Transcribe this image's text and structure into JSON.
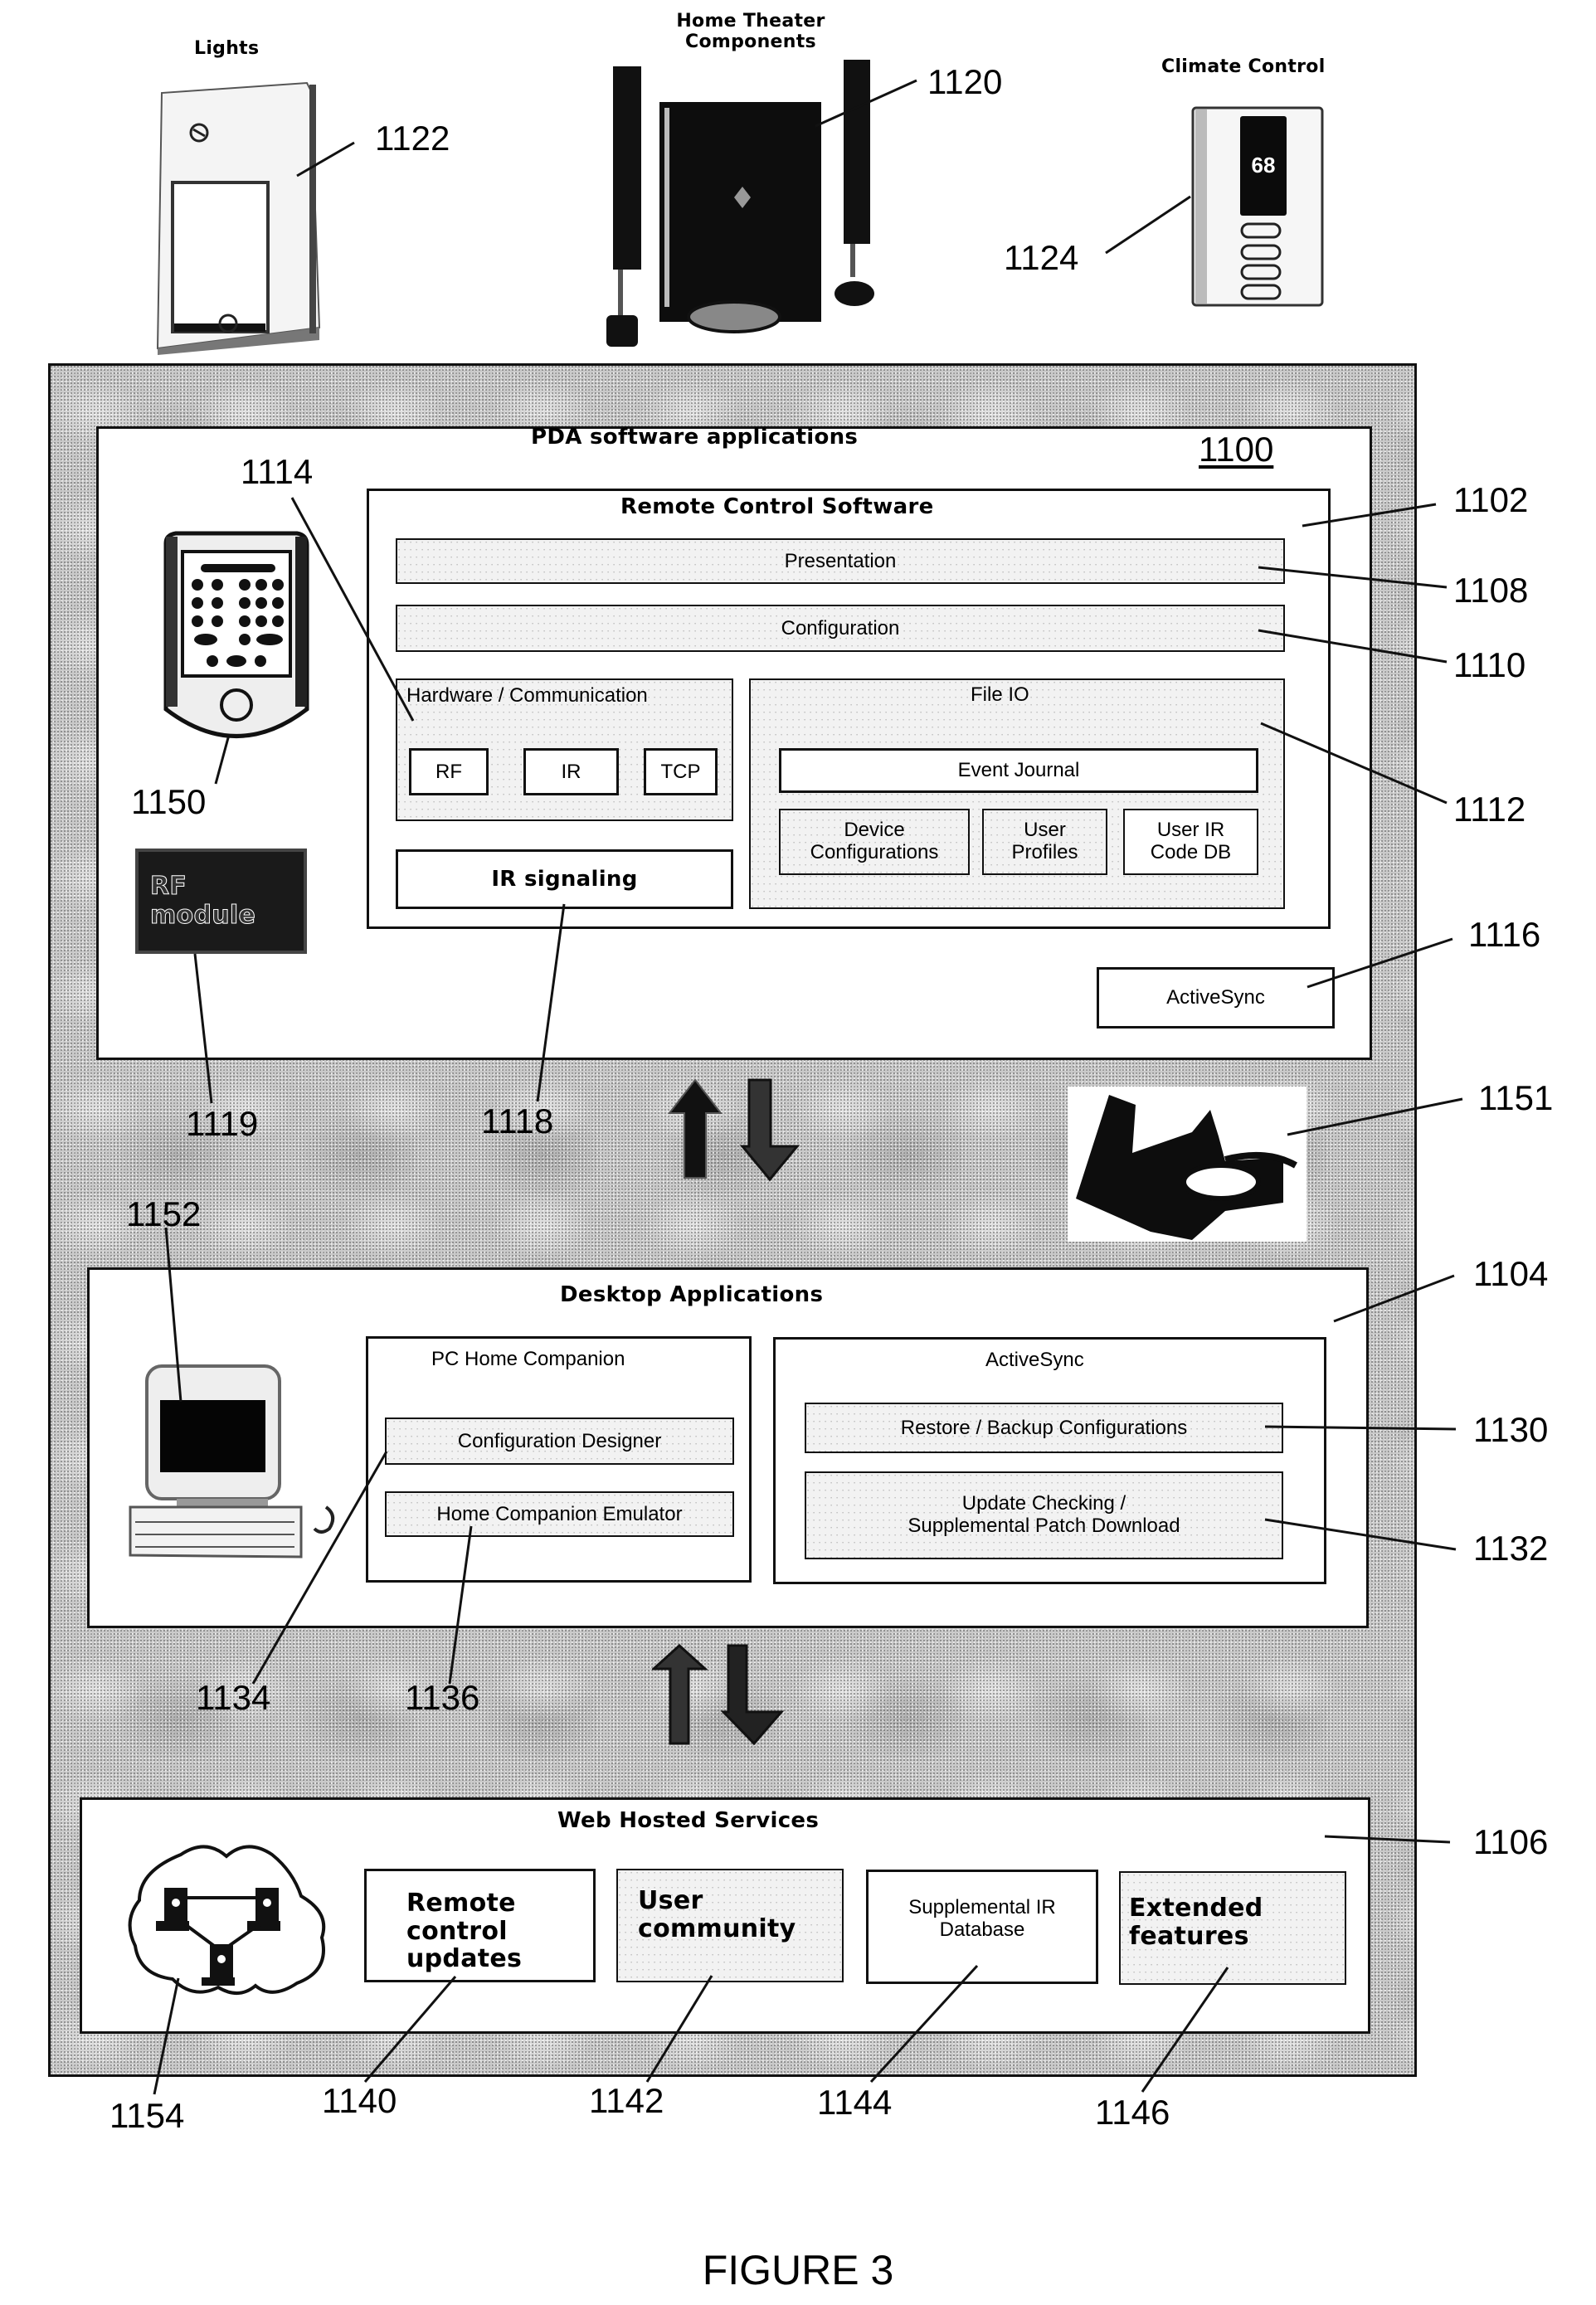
{
  "figure": {
    "caption": "FIGURE 3",
    "reference": "1100"
  },
  "devices": {
    "lights": {
      "title": "Lights",
      "ref": "1122"
    },
    "home_theater": {
      "title_line1": "Home Theater",
      "title_line2": "Components",
      "ref": "1120"
    },
    "climate": {
      "title": "Climate Control",
      "ref": "1124",
      "display_value": "68"
    }
  },
  "pda": {
    "title": "PDA software applications",
    "device_ref": "1150",
    "rf_module": {
      "line1": "RF",
      "line2": "module",
      "ref": "1119"
    },
    "remote_control_software": {
      "title": "Remote Control Software",
      "ref": "1102",
      "presentation": {
        "label": "Presentation",
        "ref": "1108"
      },
      "configuration": {
        "label": "Configuration",
        "ref": "1110"
      },
      "hardware": {
        "title": "Hardware / Communication",
        "ref": "1114",
        "items": [
          "RF",
          "IR",
          "TCP"
        ]
      },
      "ir_signaling": {
        "label": "IR signaling",
        "ref": "1118"
      },
      "file_io": {
        "title": "File IO",
        "ref": "1112",
        "event_journal": "Event Journal",
        "stores": [
          {
            "line1": "Device",
            "line2": "Configurations"
          },
          {
            "line1": "User",
            "line2": "Profiles"
          },
          {
            "line1": "User IR",
            "line2": "Code DB"
          }
        ]
      }
    },
    "activesync": {
      "label": "ActiveSync",
      "ref": "1116"
    }
  },
  "cradle": {
    "ref": "1151"
  },
  "desktop": {
    "title": "Desktop Applications",
    "ref": "1104",
    "computer_ref": "1152",
    "pc_home_companion": {
      "title": "PC Home Companion",
      "items": [
        {
          "label": "Configuration Designer",
          "ref": "1134"
        },
        {
          "label": "Home Companion Emulator",
          "ref": "1136"
        }
      ]
    },
    "activesync": {
      "title": "ActiveSync",
      "items": [
        {
          "line1": "Restore / Backup Configurations",
          "line2": "",
          "ref": "1130"
        },
        {
          "line1": "Update Checking /",
          "line2": "Supplemental Patch Download",
          "ref": "1132"
        }
      ]
    }
  },
  "web": {
    "title": "Web Hosted Services",
    "ref": "1106",
    "network_ref": "1154",
    "services": [
      {
        "lines": [
          "Remote",
          "control",
          "updates"
        ],
        "ref": "1140"
      },
      {
        "lines": [
          "User",
          "community"
        ],
        "ref": "1142"
      },
      {
        "lines": [
          "Supplemental IR",
          "Database"
        ],
        "ref": "1144"
      },
      {
        "lines": [
          "Extended",
          "features"
        ],
        "ref": "1146"
      }
    ]
  }
}
